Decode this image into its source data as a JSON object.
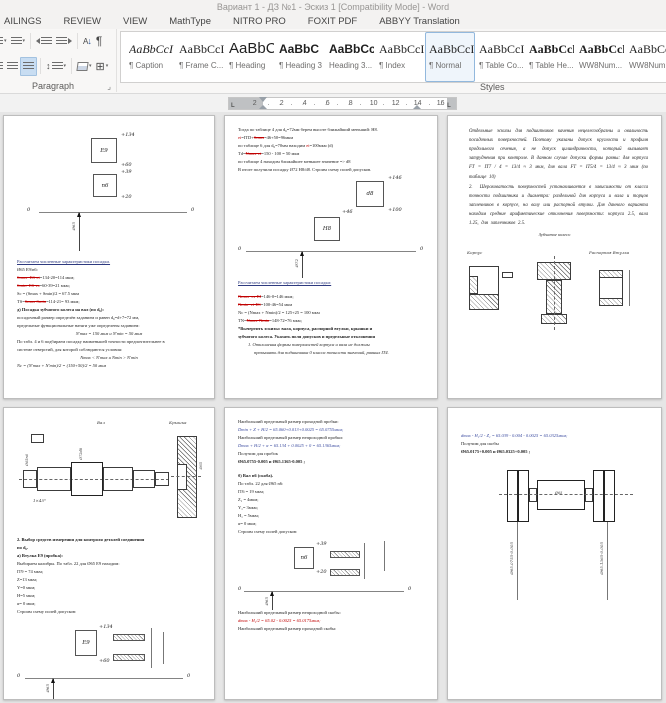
{
  "window": {
    "title": "Вариант 1 - ДЗ №1 - Эскиз 1 [Compatibility Mode] - Word"
  },
  "ribbon": {
    "tabs": [
      "AILINGS",
      "REVIEW",
      "VIEW",
      "MathType",
      "NITRO PRO",
      "FOXIT PDF",
      "ABBYY Translation"
    ],
    "paragraph_group_label": "Paragraph",
    "styles_group_label": "Styles",
    "icons": {
      "caret": "▾",
      "pilcrow": "¶",
      "borders": "⊞",
      "sort_letter": "А",
      "sort_arrow": "↓",
      "launcher": "⌟",
      "updown": "↕"
    }
  },
  "styles": [
    {
      "preview": "AaBbCcI",
      "label": "¶ Caption"
    },
    {
      "preview": "AaBbCcI",
      "label": "¶ Frame C..."
    },
    {
      "preview": "AaBbC",
      "label": "¶ Heading"
    },
    {
      "preview": "AaBbC",
      "label": "¶ Heading 3"
    },
    {
      "preview": "AaBbCc",
      "label": "Heading 3..."
    },
    {
      "preview": "AaBbCcI",
      "label": "¶ Index"
    },
    {
      "preview": "AaBbCcI",
      "label": "¶ Normal"
    },
    {
      "preview": "AaBbCcI",
      "label": "¶ Table Co..."
    },
    {
      "preview": "AaBbCcl",
      "label": "¶ Table He..."
    },
    {
      "preview": "AaBbCcl",
      "label": "WW8Num..."
    },
    {
      "preview": "AaBbCc",
      "label": "WW8Num..."
    }
  ],
  "ruler": {
    "left_num": "2",
    "numbers": [
      "2",
      "4",
      "6",
      "8",
      "10",
      "12",
      "14",
      "16"
    ],
    "tab_stop": "L"
  },
  "pages": {
    "p1": {
      "d": {
        "box1": "E9",
        "box1_top": "+134",
        "box1_bot": "+60",
        "box2": "n6",
        "box2_top": "+39",
        "box2_bot": "+20",
        "zl": "0",
        "zr": "0",
        "axis": "Ø65"
      },
      "h": "Рассчитаем численные характеристики посадки.",
      "l0": "Ø65 E9/n6:",
      "l1a": "Smax=ES-ei",
      "l1b": "=134-20=114 мкм;",
      "l2a": "Smin=ES-es",
      "l2b": "=60-39=21 мкм;",
      "l3": "Sc = (Smax + Smin)/2 = 67.5 мкм",
      "l4a": "TS=",
      "l4b": "Smax-Smin",
      "l4c": "=114-21= 93 мкм;",
      "h2": "д) Посадка зубчатого колеса на вал (по d₆):",
      "l5": "посадочный размер определён заданием и равен d₆=d+7=72 мм,",
      "l6": "предельные функциональные натяги уже определены заданием:",
      "l7": "N′max = 150 мкм и N′min = 50 мкм",
      "l8": "По табл. 4 и 6 подбираем посадку наименьшей точности предпочтительнее в",
      "l9": "системе отверстий, для которой соблюдаются условия:",
      "l10": "Nmax < N′max и Nmin > N′min",
      "l11": "Nc = (N′max + N′min)/2 = (150+50)/2 = 50 мкм"
    },
    "p2": {
      "l1": "Тогда по таблице 4 для d₆=72мм берем высоте ближайший меньший: H8.",
      "l2a": "ei",
      "l2b": "=ITD+",
      "l2c": "Smax",
      "l2d": "=46+50=96мкм",
      "l3a": "по таблице 6 для d₆=70мм находим ",
      "l3b": "ei",
      "l3c": "=100мкм (d)",
      "l4a": "Td=",
      "l4b": "Nmax-ei",
      "l4c": "=150 - 100 = 50 мкм",
      "l5": "по таблице 4 находим ближайшее меньшее значение => d8",
      "l6": "В итоге получили посадку Ø72 H8/d8. Строим схему полей допусков.",
      "d": {
        "box1": "d8",
        "box1_top": "+146",
        "box1_bot": "+100",
        "box2": "H8",
        "box2_top": "+46",
        "zl": "0",
        "zr": "0",
        "axis": "Ø72"
      },
      "h": "Рассчитаем численные характеристики посадки:",
      "l7a": "Nmax=es-EI",
      "l7b": "=146-0=146 мкм;",
      "l8a": "Nmin=ei-ES",
      "l8b": "=100-46=54 мкм",
      "l9": "Nc = (Nmax + Nmin)/2 = 125+25 = 100 мкм",
      "l10a": "TN=",
      "l10b": "Nmax-Nmin",
      "l10c": "=148-72=76 мкм;",
      "b1": "*Вычертить эскизы: вала, корпуса, распорной втулки, крышки и",
      "b2": "зубчатого колеса. Указать поля допусков и предельные отклонения",
      "i1": "1. Отклонения формы поверхностей корпуса и вала не должны",
      "i2": "превышать для подшипника 0 класса точности значений, равных IT4."
    },
    "p3": {
      "para1": "Отдельные эскизы для подшипников качения нецелесообразны и овальность посадочных поверхностей. Поэтому указаны допуск круглости и профиля продольного сечения, а не допуск цилиндричности, который вызывает затруднения при контроле. В данном случае допуски формы равны: для корпуса FT = IT7 / 4 = 13/4 ≈ 3 мкм, для вала FT = IT5/4 = 13/4 ≈ 3 мкм (по таблице 10)",
      "para2_num": "2.",
      "para2": "Шероховатость поверхностей устанавливается в зависимости от класса точности подшипника и диаметра: раздельной для корпуса и вала и торцов заплечников в корпусе, на валу или распорной втулки. Для данного варианта находим средние арифметические отклонения поверхности: корпуса 2.5, вала 1.25, для заплечников 2.5.",
      "cap": "Зубчатое колесо",
      "lbl_left": "Корпус",
      "lbl_right": "Распорная Втулка"
    },
    "p4": {
      "lbl_shaft": "Вал",
      "lbl_cap": "Крышка",
      "note": "1×45°",
      "vdim1": "Ø65n6",
      "vdim2": "Ø72d8",
      "vdim3": "Ø65",
      "h1": "2. Выбор средств измерения для контроля деталей соединения",
      "h2": "по d₆.",
      "l1": "а) Втулка E9 (пробка):",
      "l2": "Выбираем калибры. По табл. 22 для Ø65 E9 находим:",
      "l3": "IT9 = 74 мкм;",
      "l4": "Z=13 мкм;",
      "l5": "Y=0 мкм;",
      "l6": "H=5 мкм;",
      "l7": "α= 0 мкм;",
      "l8": "Строим схему полей допусков:",
      "d": {
        "box1": "E9",
        "box1_top": "+134",
        "box1_bot": "+60",
        "zl": "0",
        "zr": "0",
        "axis": "Ø65"
      }
    },
    "p5": {
      "l1": "Наибольший предельный размер проходной пробки:",
      "f1": "Dmin + Z + H/2 = 65.060+0.013+0.0025 = 65.0755мкм;",
      "l2": "Наибольший предельный размер  непроходной пробки:",
      "f2": "Dmax + H/2 + α = 65.134 + 0.0025 + 0 = 65.1365мкм;",
      "l3": "Получим для пробок",
      "l4": "Ø65.0755-0.005 и Ø65.1365-0.005 ;",
      "b": "б) Вал n6 (скоба).",
      "l5": "По табл. 22 для Ø65 n6:",
      "l6": "IT6 = 19 мкм;",
      "l7": "Z₁ = 4мкм;",
      "l8": "Y₁= 3мкм;",
      "l9": "H₁ = 5мкм;",
      "l10": "α= 0 мкм;",
      "l11": "Строим схему полей допусков:",
      "d": {
        "box1": "n6",
        "box1_top": "+39",
        "box1_bot": "+20",
        "zl": "0",
        "zr": "0",
        "axis": "Ø65"
      },
      "l12": "Наибольший предельный размер непроходной скобы:",
      "f3": "dmax - H₁/2 = 65.02 - 0.0025 = 65.0175мкм;",
      "l13": "Наибольший предельный размер  проходной скобы:"
    },
    "p6": {
      "f1": "dmax - H₁/2 - Z₁ = 65.039 - 0.004 - 0.0025 = 65.0325мкм;",
      "l1": "Получим для скобы",
      "l2": "Ø65.0175+0.005 и Ø65.0325+0.005 ;",
      "mid": "Ø65",
      "dim_left": "Ø65.0755-0.005",
      "dim_right": "Ø65.1365-0.005"
    }
  }
}
